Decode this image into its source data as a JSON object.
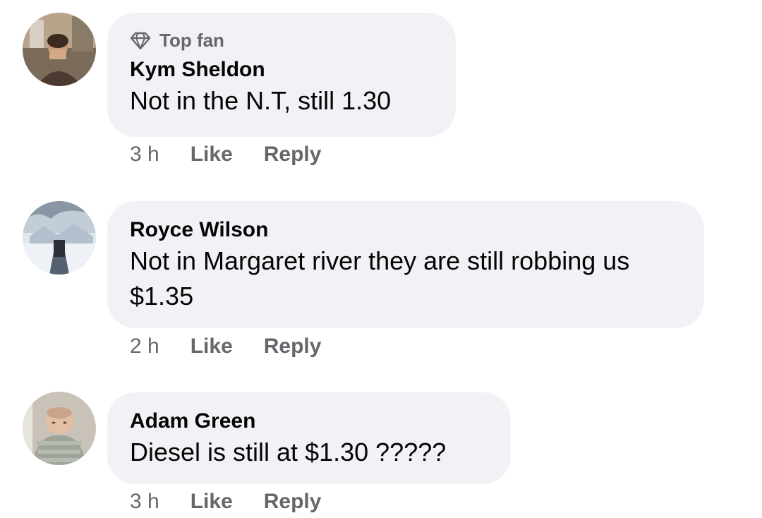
{
  "comments": [
    {
      "badge_icon": "diamond-icon",
      "badge": "Top fan",
      "author": "Kym Sheldon",
      "text": "Not in the N.T, still 1.30",
      "time": "3 h",
      "like_label": "Like",
      "reply_label": "Reply"
    },
    {
      "author": "Royce Wilson",
      "text": "Not in Margaret river they are still robbing us $1.35",
      "time": "2 h",
      "like_label": "Like",
      "reply_label": "Reply"
    },
    {
      "author": "Adam Green",
      "text": "Diesel is still at $1.30 ?????",
      "time": "3 h",
      "like_label": "Like",
      "reply_label": "Reply"
    }
  ],
  "colors": {
    "bubble_bg": "#f0f2f5",
    "secondary_text": "#65676b",
    "primary_text": "#050505"
  }
}
